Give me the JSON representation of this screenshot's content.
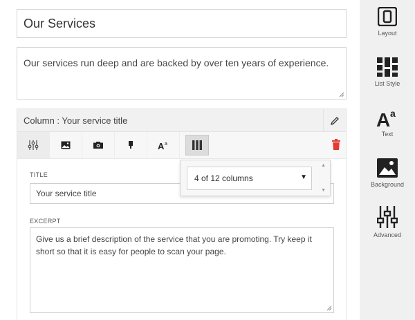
{
  "editor": {
    "title_value": "Our Services",
    "description_value": "Our services run deep and are backed by over ten years of experience."
  },
  "column": {
    "header_title": "Column : Your service title",
    "toolbar_icons": [
      "sliders-icon",
      "image-icon",
      "camera-icon",
      "brush-icon",
      "text-format-icon",
      "columns-icon"
    ],
    "title_label": "TITLE",
    "title_value": "Your service title",
    "excerpt_label": "EXCERPT",
    "excerpt_value": "Give us a brief description of the service that you are promoting. Try keep it short so that it is easy for people to scan your page."
  },
  "columns_dropdown": {
    "selected": "4 of 12 columns"
  },
  "sidebar": {
    "items": [
      {
        "label": "Layout",
        "icon": "layout-icon"
      },
      {
        "label": "List Style",
        "icon": "list-style-icon"
      },
      {
        "label": "Text",
        "icon": "text-icon"
      },
      {
        "label": "Background",
        "icon": "background-icon"
      },
      {
        "label": "Advanced",
        "icon": "advanced-icon"
      }
    ]
  },
  "colors": {
    "accent_delete": "#e53935",
    "sidebar_bg": "#f0f0f0",
    "icon_dark": "#222222"
  }
}
